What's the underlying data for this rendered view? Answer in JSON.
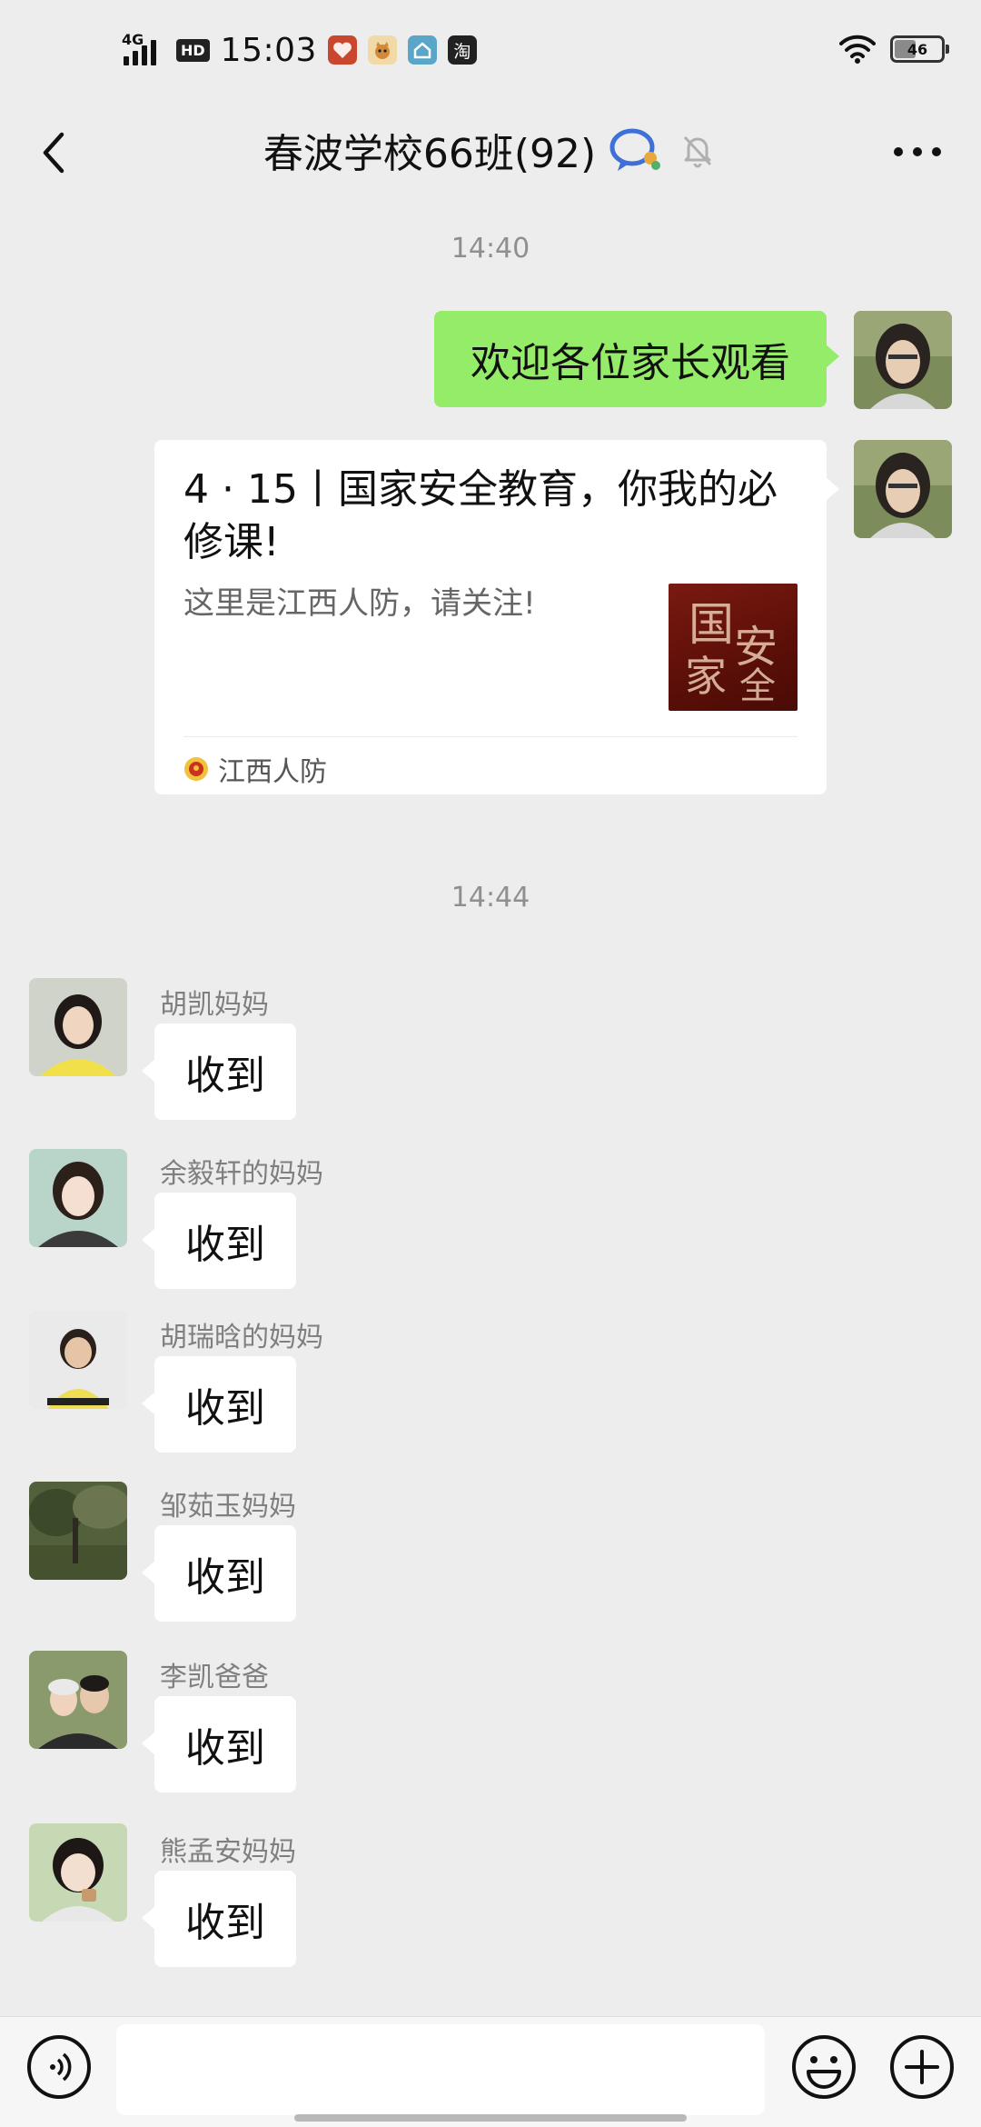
{
  "status_bar": {
    "network": "4G",
    "hd": "HD",
    "time": "15:03",
    "app_icons": [
      "heart-app-icon",
      "cat-app-icon",
      "home-app-icon",
      "taobao-app-icon"
    ],
    "taobao_glyph": "淘",
    "battery": "46"
  },
  "header": {
    "title": "春波学校66班(92)"
  },
  "timestamps": [
    "14:40",
    "14:44"
  ],
  "sent_message": {
    "text": "欢迎各位家长观看"
  },
  "article_card": {
    "title": "4 · 15丨国家安全教育，你我的必修课!",
    "description": "这里是江西人防，请关注!",
    "thumbnail_text": "国家安全",
    "source": "江西人防"
  },
  "received_messages": [
    {
      "sender": "胡凯妈妈",
      "text": "收到"
    },
    {
      "sender": "余毅轩的妈妈",
      "text": "收到"
    },
    {
      "sender": "胡瑞晗的妈妈",
      "text": "收到"
    },
    {
      "sender": "邹茹玉妈妈",
      "text": "收到"
    },
    {
      "sender": "李凯爸爸",
      "text": "收到"
    },
    {
      "sender": "熊孟安妈妈",
      "text": "收到"
    }
  ],
  "input_bar": {
    "placeholder": ""
  },
  "colors": {
    "background": "#ededed",
    "sent_bubble": "#95ec69",
    "received_bubble": "#ffffff"
  }
}
